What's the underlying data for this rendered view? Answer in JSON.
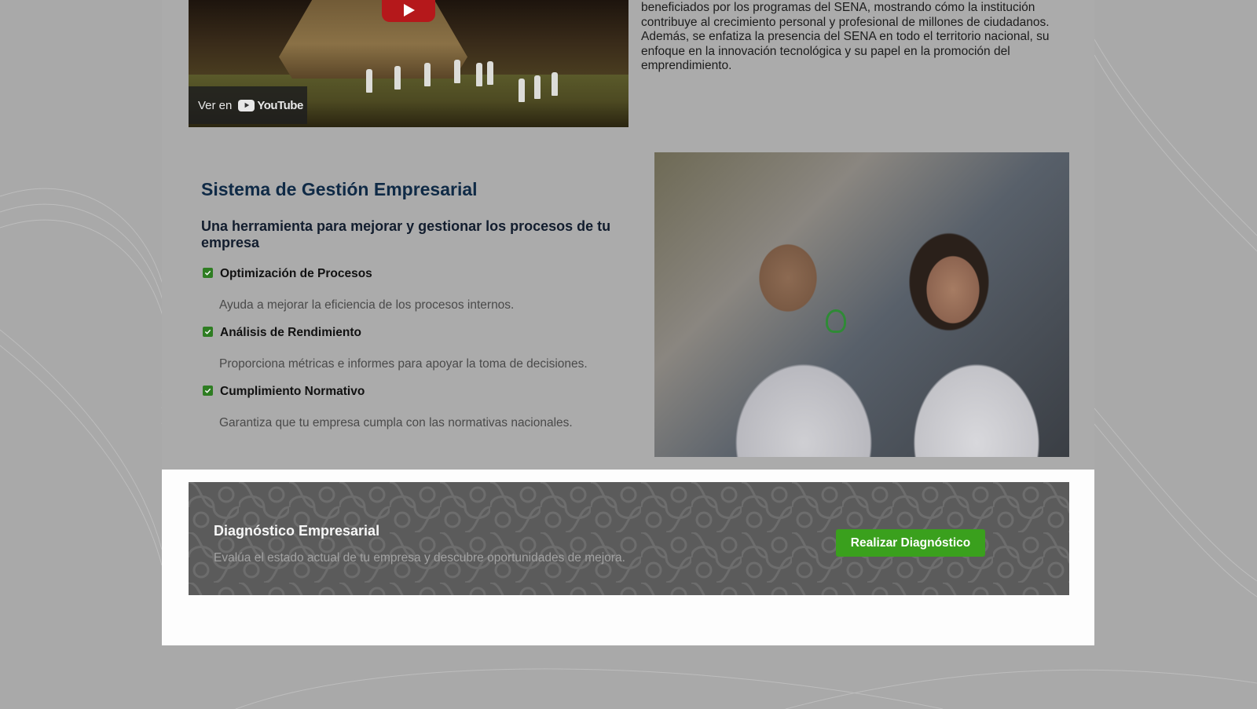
{
  "video": {
    "watch_on_label": "Ver en",
    "youtube_label": "YouTube"
  },
  "intro": {
    "text": "beneficiados por los programas del SENA, mostrando cómo la institución contribuye al crecimiento personal y profesional de millones de ciudadanos. Además, se enfatiza la presencia del SENA en todo el territorio nacional, su enfoque en la innovación tecnológica y su papel en la promoción del emprendimiento."
  },
  "section": {
    "title": "Sistema de Gestión Empresarial",
    "subtitle": "Una herramienta para mejorar y gestionar los procesos de tu empresa",
    "features": [
      {
        "title": "Optimización de Procesos",
        "description": "Ayuda a mejorar la eficiencia de los procesos internos."
      },
      {
        "title": "Análisis de Rendimiento",
        "description": "Proporciona métricas e informes para apoyar la toma de decisiones."
      },
      {
        "title": "Cumplimiento Normativo",
        "description": "Garantiza que tu empresa cumpla con las normativas nacionales."
      }
    ]
  },
  "diagnostic": {
    "title": "Diagnóstico Empresarial",
    "description": "Evalúa el estado actual de tu empresa y descubre oportunidades de mejora.",
    "button_label": "Realizar Diagnóstico"
  },
  "colors": {
    "accent_green": "#3aa01d",
    "check_green": "#2e7d22",
    "title_navy": "#0f2a46",
    "youtube_red": "#b5181b"
  }
}
